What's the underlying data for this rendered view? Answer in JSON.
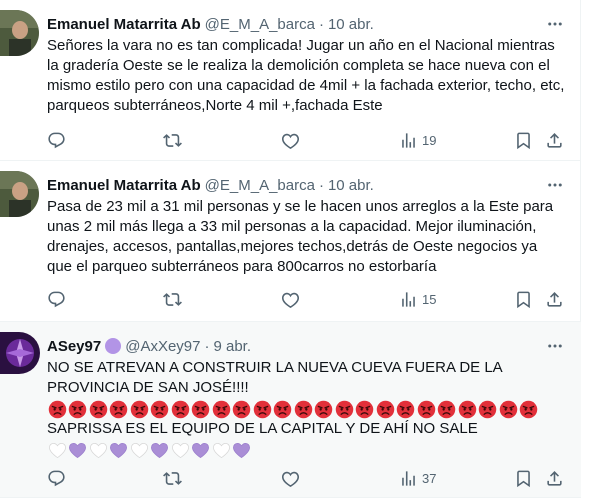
{
  "tweets": [
    {
      "name": "Emanuel Matarrita Ab",
      "handle": "@E_M_A_barca",
      "separator": "·",
      "time": "10 abr.",
      "text": "Señores la vara no es tan complicada! Jugar un año en el Nacional mientras la gradería Oeste se le realiza la demolición completa se hace nueva con el mismo estilo pero con una capacidad de 4mil + la fachada exterior, techo, etc, parqueos subterráneos,Norte 4 mil +,fachada Este",
      "views": "19"
    },
    {
      "name": "Emanuel Matarrita Ab",
      "handle": "@E_M_A_barca",
      "separator": "·",
      "time": "10 abr.",
      "text": "Pasa de 23 mil a 31 mil personas y se le hacen unos arreglos a la Este para unas 2 mil más llega a 33 mil personas a la capacidad. Mejor iluminación, drenajes, accesos, pantallas,mejores techos,detrás de Oeste negocios ya que el parqueo subterráneos para 800carros no estorbaría",
      "views": "15"
    },
    {
      "name": "ASey97",
      "handle": "@AxXey97",
      "separator": "·",
      "time": "9 abr.",
      "text_line1": "NO SE ATREVAN A CONSTRUIR LA NUEVA CUEVA FUERA DE LA PROVINCIA DE SAN JOSÉ!!!!",
      "text_line2": "SAPRISSA ES EL EQUIPO DE LA CAPITAL Y DE AHÍ NO SALE",
      "angry_emoji_count": 24,
      "heart_pattern": [
        "white",
        "purple",
        "white",
        "purple",
        "white",
        "purple",
        "white",
        "purple",
        "white",
        "purple"
      ],
      "views": "37"
    }
  ],
  "icons": {
    "more": "more-icon",
    "reply": "reply-icon",
    "retweet": "retweet-icon",
    "like": "heart-icon",
    "views": "views-icon",
    "bookmark": "bookmark-icon",
    "share": "share-icon"
  },
  "colors": {
    "text": "#0f1419",
    "secondary": "#536471",
    "verified": "#b294e6",
    "highlight_bg": "#f7f9f9"
  }
}
